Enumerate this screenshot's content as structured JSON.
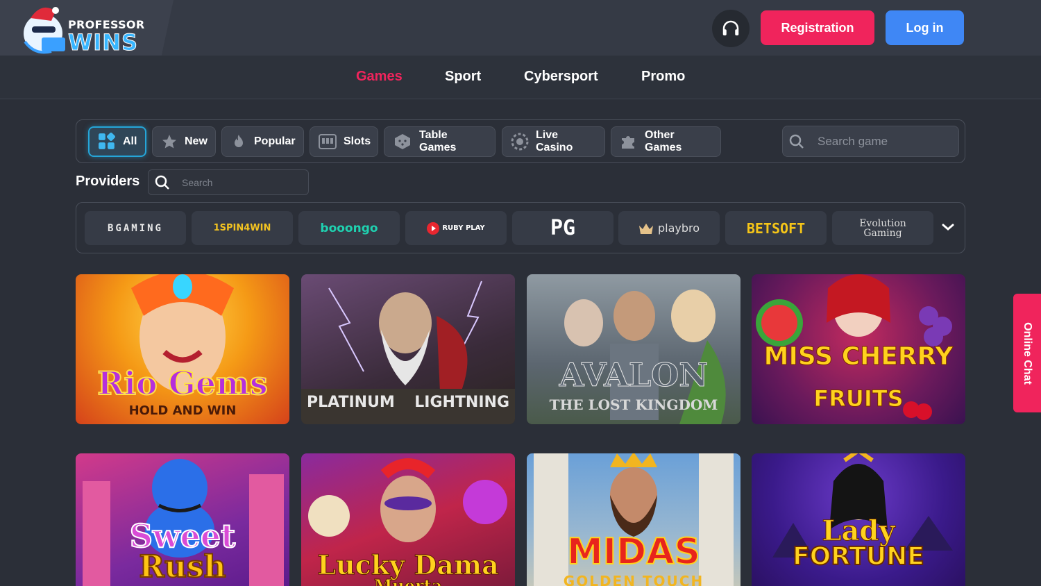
{
  "brand": {
    "line1": "PROFESSOR",
    "line2": "WINS"
  },
  "header": {
    "registration": "Registration",
    "login": "Log in"
  },
  "nav": [
    {
      "label": "Games",
      "active": true
    },
    {
      "label": "Sport"
    },
    {
      "label": "Cybersport"
    },
    {
      "label": "Promo"
    }
  ],
  "categories": [
    {
      "label": "All",
      "icon": "grid-icon",
      "active": true
    },
    {
      "label": "New",
      "icon": "star-icon"
    },
    {
      "label": "Popular",
      "icon": "flame-icon"
    },
    {
      "label": "Slots",
      "icon": "slot-machine-icon"
    },
    {
      "label": "Table Games",
      "icon": "dice-icon"
    },
    {
      "label": "Live Casino",
      "icon": "chip-icon"
    },
    {
      "label": "Other Games",
      "icon": "puzzle-icon"
    }
  ],
  "search_game": {
    "placeholder": "Search game"
  },
  "providers": {
    "title": "Providers",
    "search_placeholder": "Search",
    "items": [
      "BGAMING",
      "1SPIN4WIN",
      "booongo",
      "RUBY PLAY",
      "PG",
      "playbro",
      "BETSOFT",
      "Evolution Gaming"
    ]
  },
  "games": [
    {
      "line1": "Rio Gems",
      "line2": "HOLD AND WIN"
    },
    {
      "line1": "PLATINUM",
      "line2": "LIGHTNING"
    },
    {
      "line1": "AVALON",
      "line2": "THE LOST KINGDOM"
    },
    {
      "line1": "MISS CHERRY",
      "line2": "FRUITS"
    },
    {
      "line1": "Sweet",
      "line2": "Rush"
    },
    {
      "line1": "Lucky Dama",
      "line2": "Muerta"
    },
    {
      "line1": "MIDAS",
      "line2": "GOLDEN TOUCH"
    },
    {
      "line1": "Lady",
      "line2": "FORTUNE"
    }
  ],
  "online_chat": "Online Chat",
  "colors": {
    "accent": "#f0245c",
    "login": "#3f87f5",
    "active_cat": "#25a6d9"
  }
}
